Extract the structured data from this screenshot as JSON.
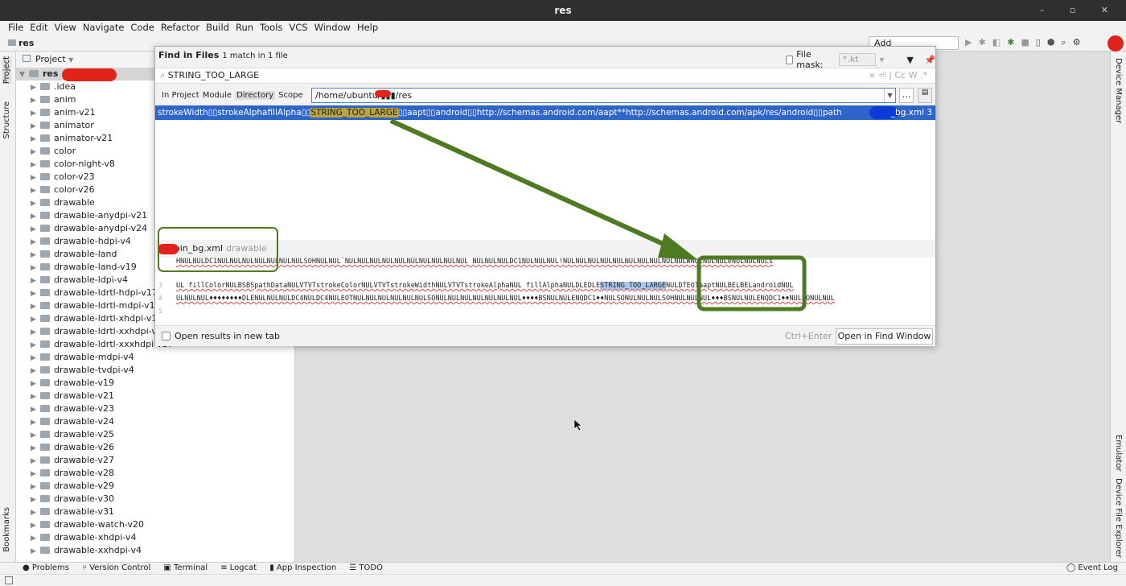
{
  "window": {
    "title": "res",
    "controls": "– ▫ ✕"
  },
  "menu": [
    "File",
    "Edit",
    "View",
    "Navigate",
    "Code",
    "Refactor",
    "Build",
    "Run",
    "Tools",
    "VCS",
    "Window",
    "Help"
  ],
  "breadcrumb": "res",
  "toolbar": {
    "add_config": "Add Configuration..."
  },
  "left_strip": {
    "project": "Project",
    "structure": "Structure",
    "bookmarks": "Bookmarks"
  },
  "right_strip": {
    "device_manager": "Device Manager",
    "emulator": "Emulator",
    "device_file_explorer": "Device File Explorer"
  },
  "project": {
    "header": "Project",
    "root": "res",
    "items": [
      ".idea",
      "anim",
      "anim-v21",
      "animator",
      "animator-v21",
      "color",
      "color-night-v8",
      "color-v23",
      "color-v26",
      "drawable",
      "drawable-anydpi-v21",
      "drawable-anydpi-v24",
      "drawable-hdpi-v4",
      "drawable-land",
      "drawable-land-v19",
      "drawable-ldpi-v4",
      "drawable-ldrtl-hdpi-v17",
      "drawable-ldrtl-mdpi-v17",
      "drawable-ldrtl-xhdpi-v17",
      "drawable-ldrtl-xxhdpi-v17",
      "drawable-ldrtl-xxxhdpi-v17",
      "drawable-mdpi-v4",
      "drawable-tvdpi-v4",
      "drawable-v19",
      "drawable-v21",
      "drawable-v23",
      "drawable-v24",
      "drawable-v25",
      "drawable-v26",
      "drawable-v27",
      "drawable-v28",
      "drawable-v29",
      "drawable-v30",
      "drawable-v31",
      "drawable-watch-v20",
      "drawable-xhdpi-v4",
      "drawable-xxhdpi-v4"
    ]
  },
  "find": {
    "title": "Find in Files",
    "summary": "1 match in 1 file",
    "file_mask_label": "File mask:",
    "file_mask_value": "*.kt",
    "query": "STRING_TOO_LARGE",
    "search_options": "× ⏎ | Cc W .*",
    "scopes": [
      "In Project",
      "Module",
      "Directory",
      "Scope"
    ],
    "active_scope": "Directory",
    "directory": "/home/ubuntu/▮▮▮/res",
    "result": {
      "before": "strokeWidth▯▯strokeAlphafillAlpha▯▯",
      "match": "STRING_TOO_LARGE",
      "after": "▯▯aapt▯▯android▯▯http://schemas.android.com/aapt**http://schemas.android.com/apk/res/android▯▯path",
      "file": "_bg.xml 3"
    },
    "preview_file": "oin_bg.xml",
    "preview_folder": "drawable",
    "preview_lines": [
      {
        "n": "",
        "text": "HNULNULDC1NULNULNULNULNULNULNULSOHNULNUL`NULNULNULNULNULNULNULNULNULNUL      NULNULNULDC1NULNULNUL!NULNULNULNULNULNULNULNULNULNULWNULNULNULeNULNULNULs"
      },
      {
        "n": "3",
        "pre": "UL       fillColorNULBSBSpathDataNULVTVTstrokeColorNULVTVTstrokeWidthNULVTVTstrokeAlphaNUL        fillAlphaNULDLEDLE",
        "match": "STRING_TOO_LARGE",
        "post": "NULDTEOTaaptNULBELBELandroidNUL"
      },
      {
        "n": "4",
        "text": "ULNULNUL♦♦♦♦♦♦♦♦DLENULNULNULDC4NULDC4NULEOTNULNULNULNULNULNULSONULNULNULNULNULNULNUL♦♦♦♦BSNULNULENQDC1♦♦NULSONULNULNULSOHNULNULNUL♦♦♦BSNULNULENQDC1♦♦NULSONULNUL"
      },
      {
        "n": "5",
        "text": ""
      }
    ],
    "open_new_tab": "Open results in new tab",
    "shortcut": "Ctrl+Enter",
    "open_window_button": "Open in Find Window"
  },
  "bottom_tabs": [
    "Problems",
    "Version Control",
    "Terminal",
    "Logcat",
    "App Inspection",
    "TODO"
  ],
  "event_log": "Event Log",
  "colors": {
    "selection": "#2f65ca",
    "match_highlight": "#bca43f",
    "annotation": "#4e7a22",
    "redaction": "#e2231a"
  }
}
